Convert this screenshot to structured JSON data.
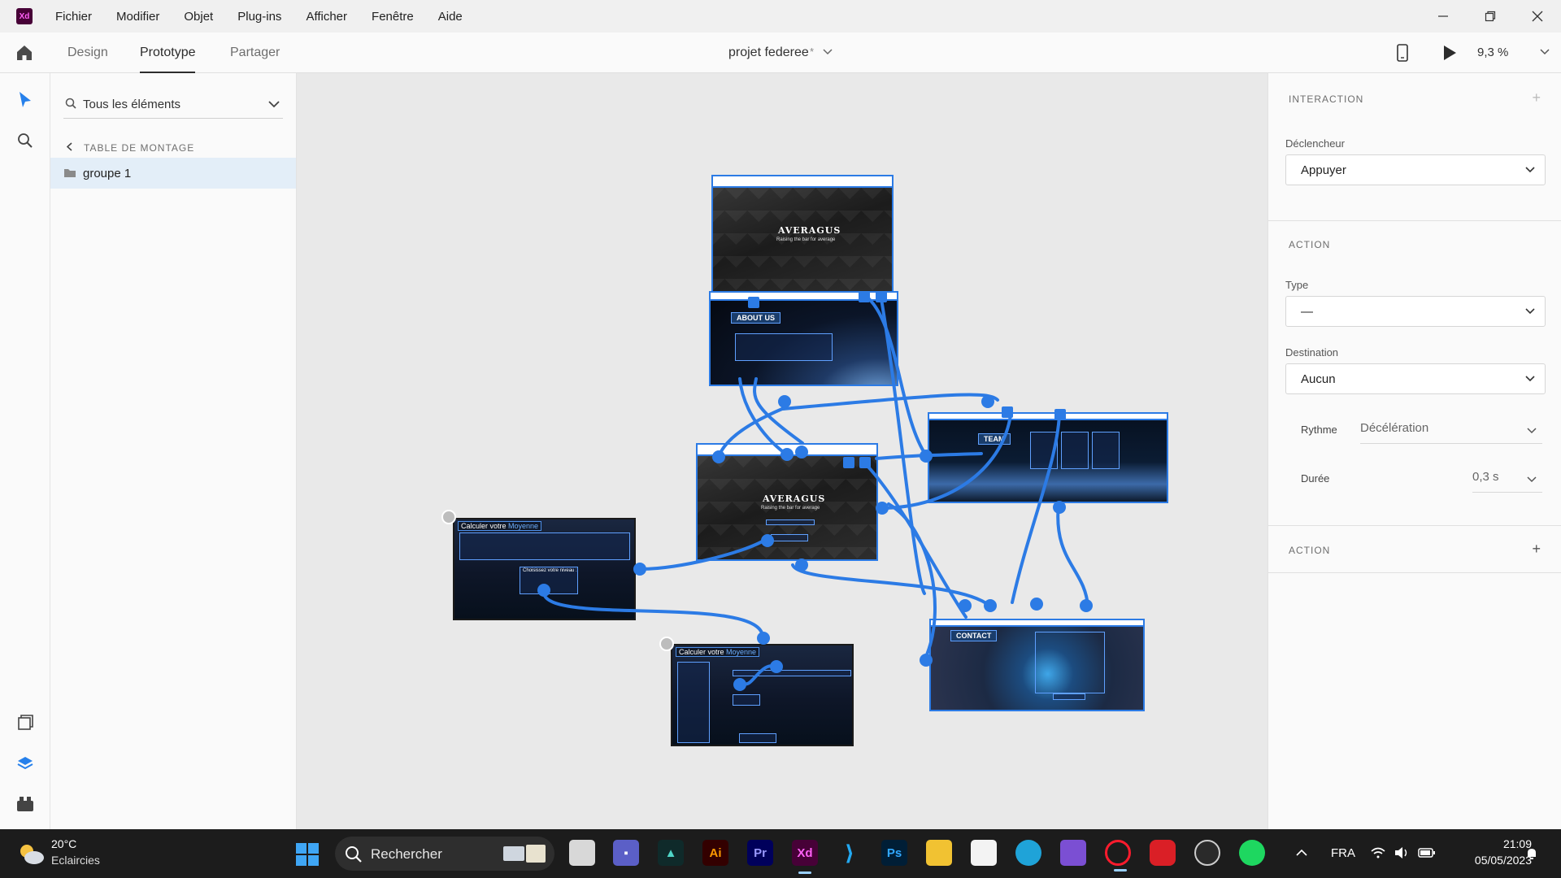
{
  "app": {
    "logo": "Xd",
    "accent": "#470137",
    "wire_color": "#2c7be5"
  },
  "menu": [
    "Fichier",
    "Modifier",
    "Objet",
    "Plug-ins",
    "Afficher",
    "Fenêtre",
    "Aide"
  ],
  "window_controls": {
    "minimize": "minimize-icon",
    "restore": "restore-icon",
    "close": "close-icon"
  },
  "modebar": {
    "tabs": [
      "Design",
      "Prototype",
      "Partager"
    ],
    "active_tab": "Prototype",
    "document_title": "projet federee",
    "unsaved_marker": "*",
    "zoom": "9,3 %"
  },
  "toolbar": [
    "select-tool-icon",
    "zoom-tool-icon",
    "document-assets-icon",
    "layers-icon",
    "plugins-icon"
  ],
  "layers_panel": {
    "search_placeholder": "Tous les éléments",
    "breadcrumb": "TABLE DE MONTAGE",
    "items": [
      {
        "label": "groupe 1",
        "icon": "folder-icon"
      }
    ]
  },
  "canvas": {
    "artboards": {
      "home": {
        "title": "AVERAGUS",
        "subtitle": "Raising the bar for average"
      },
      "about": {
        "label": "ABOUT US"
      },
      "main": {
        "title": "AVERAGUS",
        "subtitle": "Raising the bar for average"
      },
      "team": {
        "label": "TEAM"
      },
      "contact": {
        "label": "CONTACT"
      },
      "calc1": {
        "title_a": "Calculer votre ",
        "title_b": "Moyenne",
        "choose": "Choisissez votre niveau :"
      },
      "calc2": {
        "title_a": "Calculer votre ",
        "title_b": "Moyenne"
      }
    }
  },
  "interaction_panel": {
    "section_interaction": "INTERACTION",
    "trigger_label": "Déclencheur",
    "trigger_value": "Appuyer",
    "section_action": "ACTION",
    "type_label": "Type",
    "type_value": "—",
    "destination_label": "Destination",
    "destination_value": "Aucun",
    "easing_label": "Rythme",
    "easing_value": "Décélération",
    "duration_label": "Durée",
    "duration_value": "0,3 s",
    "section_action_2": "ACTION"
  },
  "taskbar": {
    "weather_temp": "20°C",
    "weather_desc": "Eclaircies",
    "search_placeholder": "Rechercher",
    "language": "FRA",
    "time": "21:09",
    "date": "05/05/2023",
    "apps": [
      "task-view",
      "teams",
      "aftermath",
      "illustrator",
      "premiere",
      "xd",
      "vscode",
      "photoshop",
      "file-explorer",
      "store",
      "edge",
      "visual-studio",
      "opera",
      "creative-cloud",
      "obs",
      "spotify"
    ],
    "app_labels": {
      "illustrator": "Ai",
      "premiere": "Pr",
      "xd": "Xd",
      "photoshop": "Ps"
    }
  }
}
